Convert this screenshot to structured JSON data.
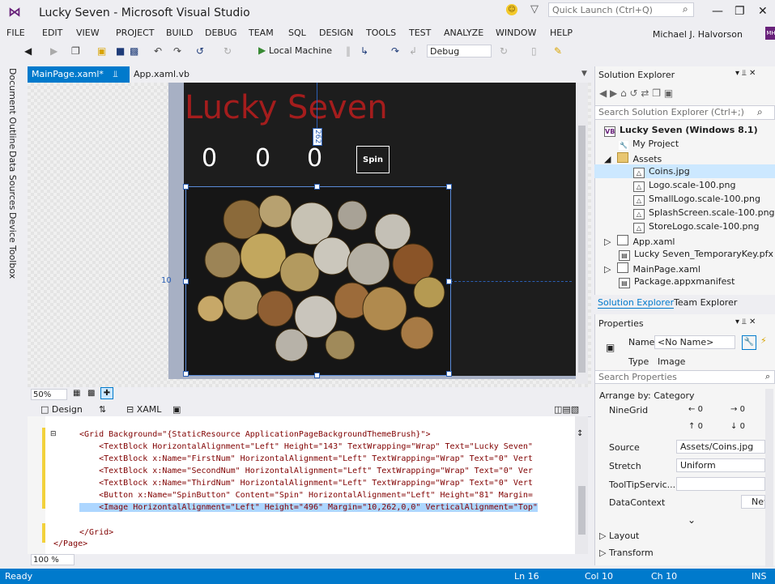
{
  "window": {
    "title": "Lucky Seven - Microsoft Visual Studio",
    "quick_launch_placeholder": "Quick Launch (Ctrl+Q)",
    "user": "Michael J. Halvorson",
    "user_initials": "MH"
  },
  "menu": [
    "FILE",
    "EDIT",
    "VIEW",
    "PROJECT",
    "BUILD",
    "DEBUG",
    "TEAM",
    "SQL",
    "DESIGN",
    "TOOLS",
    "TEST",
    "ANALYZE",
    "WINDOW",
    "HELP"
  ],
  "toolbar": {
    "run_target": "Local Machine",
    "configuration": "Debug"
  },
  "left_rail": [
    "Document Outline",
    "Data Sources",
    "Device",
    "Toolbox"
  ],
  "doc_tabs": {
    "active": "MainPage.xaml*",
    "other": "App.xaml.vb"
  },
  "designer": {
    "app_heading": "Lucky Seven",
    "digits": [
      "0",
      "0",
      "0"
    ],
    "spin_label": "Spin",
    "margin_top": "262",
    "margin_left": "10",
    "zoom": "50%"
  },
  "split_tabs": {
    "design": "Design",
    "xaml": "XAML"
  },
  "xaml_lines": [
    "<Grid Background=\"{StaticResource ApplicationPageBackgroundThemeBrush}\">",
    "    <TextBlock HorizontalAlignment=\"Left\" Height=\"143\" TextWrapping=\"Wrap\" Text=\"Lucky Seven\"",
    "    <TextBlock x:Name=\"FirstNum\" HorizontalAlignment=\"Left\" TextWrapping=\"Wrap\" Text=\"0\" Vert",
    "    <TextBlock x:Name=\"SecondNum\" HorizontalAlignment=\"Left\" TextWrapping=\"Wrap\" Text=\"0\" Ver",
    "    <TextBlock x:Name=\"ThirdNum\" HorizontalAlignment=\"Left\" TextWrapping=\"Wrap\" Text=\"0\" Vert",
    "    <Button x:Name=\"SpinButton\" Content=\"Spin\" HorizontalAlignment=\"Left\" Height=\"81\" Margin=",
    "    <Image HorizontalAlignment=\"Left\" Height=\"496\" Margin=\"10,262,0,0\" VerticalAlignment=\"Top\"",
    "",
    "</Grid>",
    "</Page>"
  ],
  "editor_zoom": "100 %",
  "solution_explorer": {
    "title": "Solution Explorer",
    "search_placeholder": "Search Solution Explorer (Ctrl+;)",
    "items": [
      "Lucky Seven (Windows 8.1)",
      "My Project",
      "Assets",
      "Coins.jpg",
      "Logo.scale-100.png",
      "SmallLogo.scale-100.png",
      "SplashScreen.scale-100.png",
      "StoreLogo.scale-100.png",
      "App.xaml",
      "Lucky Seven_TemporaryKey.pfx",
      "MainPage.xaml",
      "Package.appxmanifest"
    ],
    "tabs": [
      "Solution Explorer",
      "Team Explorer"
    ]
  },
  "properties": {
    "title": "Properties",
    "name_label": "Name",
    "name_value": "<No Name>",
    "type_label": "Type",
    "type_value": "Image",
    "search_placeholder": "Search Properties",
    "arrange_by": "Arrange by: Category",
    "ninegrid_label": "NineGrid",
    "ninegrid_values": [
      "0",
      "0",
      "0",
      "0"
    ],
    "source_label": "Source",
    "source_value": "Assets/Coins.jpg",
    "stretch_label": "Stretch",
    "stretch_value": "Uniform",
    "tooltip_label": "ToolTipServic...",
    "datacontext_label": "DataContext",
    "new_button": "New",
    "layout_label": "Layout",
    "transform_label": "Transform"
  },
  "status": {
    "state": "Ready",
    "ln": "Ln 16",
    "col": "Col 10",
    "ch": "Ch 10",
    "mode": "INS"
  },
  "colors": {
    "accent": "#007acc",
    "brand": "#68217a",
    "app_heading": "#a41d1d"
  }
}
